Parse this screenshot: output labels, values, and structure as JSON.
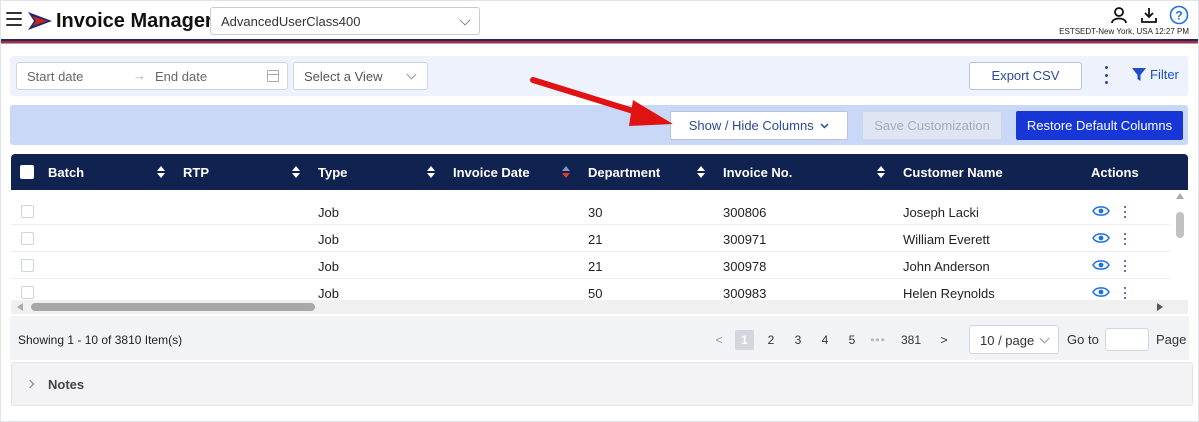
{
  "app": {
    "title": "Invoice Manager",
    "account": "AdvancedUserClass400",
    "timezone": "ESTSEDT-New York, USA 12:27 PM"
  },
  "filters": {
    "start_placeholder": "Start date",
    "arrow": "→",
    "end_placeholder": "End date",
    "view_placeholder": "Select a View",
    "export_label": "Export CSV",
    "filter_label": "Filter"
  },
  "columns_bar": {
    "show_hide_label": "Show / Hide Columns",
    "save_label": "Save Customization",
    "restore_label": "Restore Default Columns"
  },
  "table": {
    "headers": [
      "Batch",
      "RTP",
      "Type",
      "Invoice Date",
      "Department",
      "Invoice No.",
      "Customer Name",
      "Actions"
    ],
    "rows": [
      {
        "type": "Job",
        "department": "30",
        "invoice_no": "300806",
        "customer": "Joseph Lacki"
      },
      {
        "type": "Job",
        "department": "21",
        "invoice_no": "300971",
        "customer": "William Everett"
      },
      {
        "type": "Job",
        "department": "21",
        "invoice_no": "300978",
        "customer": "John Anderson"
      },
      {
        "type": "Job",
        "department": "50",
        "invoice_no": "300983",
        "customer": "Helen Reynolds"
      }
    ]
  },
  "pagination": {
    "showing": "Showing 1 - 10 of 3810 Item(s)",
    "prev": "<",
    "pages": [
      "1",
      "2",
      "3",
      "4",
      "5"
    ],
    "ellipsis": "•••",
    "last": "381",
    "next": ">",
    "page_size": "10 / page",
    "goto_label": "Go to",
    "page_label": "Page"
  },
  "notes": {
    "label": "Notes"
  },
  "colors": {
    "header_navy": "#10224f",
    "primary_blue": "#1736d6",
    "column_bar": "#cad8f8",
    "filter_bar": "#eef2fc",
    "annotation_red": "#e01212"
  },
  "icons": [
    "menu-icon",
    "logo-icon",
    "user-icon",
    "download-icon",
    "help-icon",
    "calendar-icon",
    "filter-icon",
    "eye-icon",
    "kebab-icon"
  ]
}
